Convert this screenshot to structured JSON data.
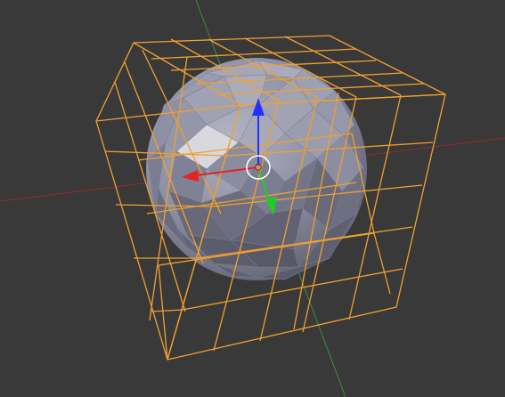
{
  "scene": {
    "background_color": "#393939",
    "axis_x_color": "#8e2f2f",
    "axis_y_color": "#3f8f3f",
    "lattice_color": "#f0a030",
    "sphere_base_color": "#8d8fa3",
    "sphere_highlight_color": "#d6d6dc",
    "sphere_shadow_color": "#50525f"
  },
  "gizmo": {
    "x_arrow_color": "#e82020",
    "y_arrow_color": "#20d020",
    "z_arrow_color": "#2030ff",
    "pivot_ring_color": "#ffffff",
    "pivot_center_color": "#f08860"
  },
  "icons": {
    "pivot": "object-origin-icon",
    "x_arrow": "arrow-x-icon",
    "y_arrow": "arrow-y-icon",
    "z_arrow": "arrow-z-icon"
  }
}
